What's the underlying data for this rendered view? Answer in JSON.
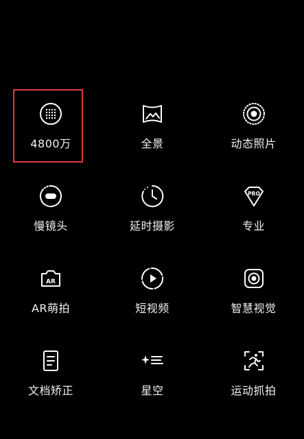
{
  "highlight_color": "#e23a3a",
  "modes": [
    {
      "label": "4800万",
      "icon": "grid-dots-icon",
      "selected": true
    },
    {
      "label": "全景",
      "icon": "panorama-icon"
    },
    {
      "label": "动态照片",
      "icon": "live-photo-icon"
    },
    {
      "label": "慢镜头",
      "icon": "slow-motion-icon"
    },
    {
      "label": "延时摄影",
      "icon": "timelapse-icon"
    },
    {
      "label": "专业",
      "icon": "pro-badge-icon"
    },
    {
      "label": "AR萌拍",
      "icon": "ar-camera-icon"
    },
    {
      "label": "短视频",
      "icon": "short-video-icon"
    },
    {
      "label": "智慧视觉",
      "icon": "smart-vision-icon"
    },
    {
      "label": "文档矫正",
      "icon": "document-icon"
    },
    {
      "label": "星空",
      "icon": "starry-sky-icon"
    },
    {
      "label": "运动抓拍",
      "icon": "sports-capture-icon"
    }
  ]
}
